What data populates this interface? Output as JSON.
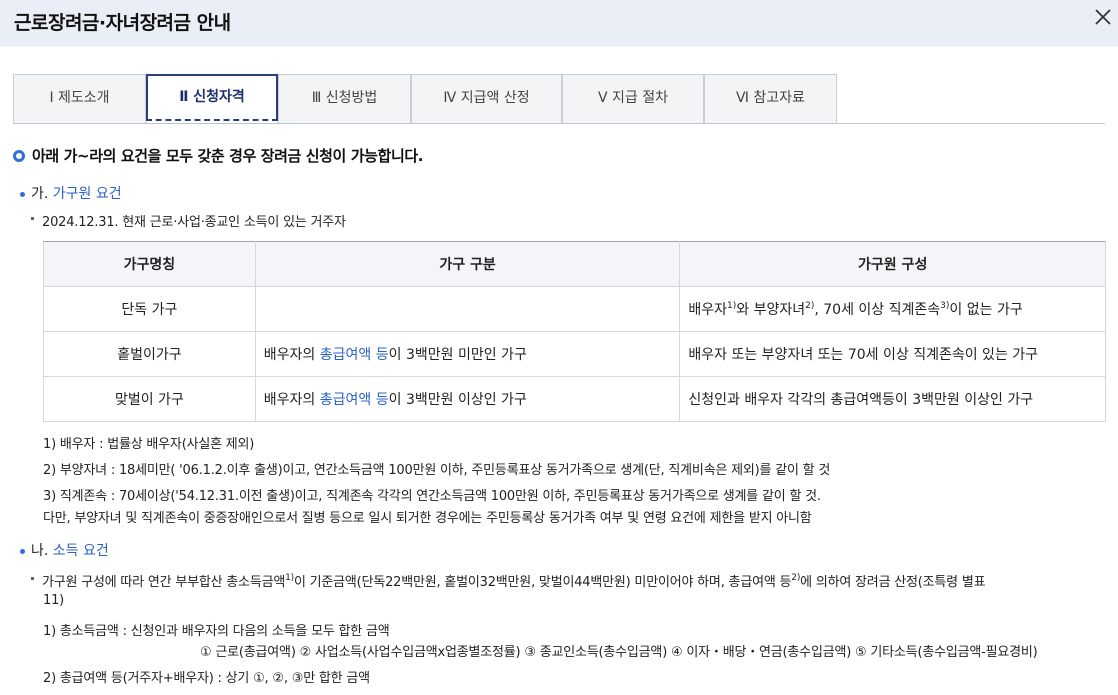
{
  "window": {
    "title": "근로장려금·자녀장려금 안내"
  },
  "tabs": [
    {
      "label": "Ⅰ  제도소개"
    },
    {
      "label": "Ⅱ  신청자격"
    },
    {
      "label": "Ⅲ  신청방법"
    },
    {
      "label": "Ⅳ  지급액 산정"
    },
    {
      "label": "Ⅴ  지급 절차"
    },
    {
      "label": "Ⅵ  참고자료"
    }
  ],
  "main_heading": "아래 가~라의 요건을 모두 갖춘 경우 장려금 신청이 가능합니다.",
  "section_ga": {
    "prefix": "가.",
    "title": "가구원 요건",
    "sub": "2024.12.31. 현재 근로·사업·종교인 소득이 있는 거주자",
    "table": {
      "headers": [
        "가구명칭",
        "가구 구분",
        "가구원 구성"
      ],
      "rows": [
        {
          "name": "단독 가구",
          "div": "",
          "comp_a": "배우자",
          "sup1": "1)",
          "comp_b": "와 부양자녀",
          "sup2": "2)",
          "comp_c": ", 70세 이상 직계존속",
          "sup3": "3)",
          "comp_d": "이 없는 가구"
        },
        {
          "name": "홑벌이가구",
          "div_a": "배우자의 ",
          "div_link": "총급여액 등",
          "div_b": "이 3백만원 미만인 가구",
          "comp": "배우자 또는 부양자녀 또는 70세 이상 직계존속이 있는 가구"
        },
        {
          "name": "맞벌이 가구",
          "div_a": "배우자의 ",
          "div_link": "총급여액 등",
          "div_b": "이 3백만원 이상인 가구",
          "comp": "신청인과 배우자 각각의 총급여액등이 3백만원 이상인 가구"
        }
      ]
    },
    "notes": [
      "1) 배우자 : 법률상 배우자(사실혼 제외)",
      "2) 부양자녀 : 18세미만( '06.1.2.이후 출생)이고, 연간소득금액 100만원 이하, 주민등록표상 동거가족으로 생계(단, 직계비속은 제외)를 같이 할 것",
      "3) 직계존속 : 70세이상('54.12.31.이전 출생)이고, 직계존속 각각의 연간소득금액 100만원 이하, 주민등록표상 동거가족으로 생계를 같이 할 것.",
      "다만, 부양자녀 및 직계존속이 중증장애인으로서 질병 등으로 일시 퇴거한 경우에는 주민등록상 동거가족 여부 및 연령 요건에 제한을 받지 아니함"
    ]
  },
  "section_na": {
    "prefix": "나.",
    "title": "소득 요건",
    "desc_a": "가구원 구성에 따라 연간 부부합산 총소득금액",
    "desc_sup1": "1)",
    "desc_b": "이 기준금액(단독22백만원, 홑벌이32백만원, 맞벌이44백만원) 미만이어야 하며, 총급여액 등",
    "desc_sup2": "2)",
    "desc_c": "에 의하여 장려금 산정(조특령 별표",
    "desc_d": "11)",
    "items": [
      "1) 총소득금액 : 신청인과 배우자의 다음의 소득을 모두 합한 금액",
      "① 근로(총급여액) ② 사업소득(사업수입금액x업종별조정률) ③ 종교인소득(총수입금액) ④ 이자・배당・연금(총수입금액) ⑤ 기타소득(총수입금액-필요경비)",
      "2) 총급여액 등(거주자+배우자) : 상기 ①, ②, ③만 합한 금액"
    ]
  }
}
